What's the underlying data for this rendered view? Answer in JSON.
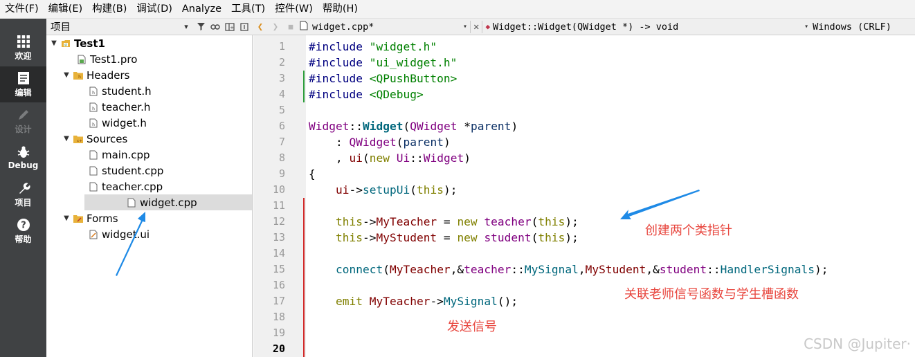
{
  "menu": [
    "文件(F)",
    "编辑(E)",
    "构建(B)",
    "调试(D)",
    "Analyze",
    "工具(T)",
    "控件(W)",
    "帮助(H)"
  ],
  "modes": [
    {
      "label": "欢迎",
      "icon": "grid-icon"
    },
    {
      "label": "编辑",
      "icon": "document-icon"
    },
    {
      "label": "设计",
      "icon": "pencil-icon"
    },
    {
      "label": "Debug",
      "icon": "bug-icon"
    },
    {
      "label": "项目",
      "icon": "wrench-icon"
    },
    {
      "label": "帮助",
      "icon": "question-icon"
    }
  ],
  "project_panel": {
    "title": "项目",
    "tree": [
      {
        "label": "Test1",
        "icon": "project-icon",
        "expanded": true
      },
      {
        "label": "Test1.pro",
        "icon": "pro-file-icon"
      },
      {
        "label": "Headers",
        "icon": "headers-folder-icon",
        "expanded": true
      },
      {
        "label": "student.h",
        "icon": "header-file-icon"
      },
      {
        "label": "teacher.h",
        "icon": "header-file-icon"
      },
      {
        "label": "widget.h",
        "icon": "header-file-icon"
      },
      {
        "label": "Sources",
        "icon": "sources-folder-icon",
        "expanded": true
      },
      {
        "label": "main.cpp",
        "icon": "cpp-file-icon"
      },
      {
        "label": "student.cpp",
        "icon": "cpp-file-icon"
      },
      {
        "label": "teacher.cpp",
        "icon": "cpp-file-icon"
      },
      {
        "label": "widget.cpp",
        "icon": "cpp-file-icon",
        "selected": true
      },
      {
        "label": "Forms",
        "icon": "forms-folder-icon",
        "expanded": true
      },
      {
        "label": "widget.ui",
        "icon": "ui-file-icon"
      }
    ]
  },
  "editor": {
    "file_tab": "widget.cpp*",
    "symbol": "Widget::Widget(QWidget *) -> void",
    "line_ending": "Windows (CRLF)",
    "current_line": 20,
    "line_numbers": [
      "1",
      "2",
      "3",
      "4",
      "5",
      "6",
      "7",
      "8",
      "9",
      "10",
      "11",
      "12",
      "13",
      "14",
      "15",
      "16",
      "17",
      "18",
      "19",
      "20"
    ],
    "lines": [
      "#include \"widget.h\"",
      "#include \"ui_widget.h\"",
      "#include <QPushButton>",
      "#include <QDebug>",
      "",
      "Widget::Widget(QWidget *parent)",
      "    : QWidget(parent)",
      "    , ui(new Ui::Widget)",
      "{",
      "    ui->setupUi(this);",
      "",
      "    this->MyTeacher = new teacher(this);",
      "    this->MyStudent = new student(this);",
      "",
      "    connect(MyTeacher,&teacher::MySignal,MyStudent,&student::HandlerSignals);",
      "",
      "    emit MyTeacher->MySignal();",
      "",
      "",
      ""
    ]
  },
  "annotations": {
    "create_pointers": "创建两个类指针",
    "connect_note": "关联老师信号函数与学生槽函数",
    "emit_note": "发送信号"
  },
  "watermark": "CSDN @Jupiter·",
  "colors": {
    "modebar": "#404244",
    "annotation": "#e8473f",
    "arrow": "#1e8ae6",
    "modified_marker_green": "#2e9e3c",
    "modified_marker_red": "#d22a2a"
  }
}
